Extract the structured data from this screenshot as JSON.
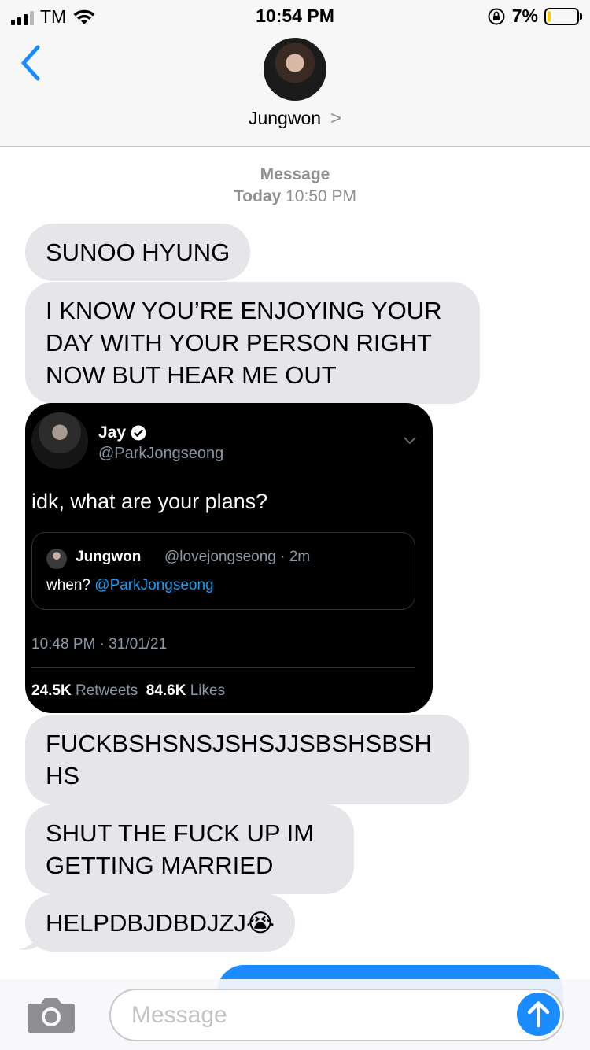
{
  "status_bar": {
    "carrier": "TM",
    "time": "10:54 PM",
    "battery": "7%",
    "battery_level": 0.07
  },
  "header": {
    "contact_name": "Jungwon",
    "contact_chevron": ">"
  },
  "conversation_meta": {
    "label": "Message",
    "day": "Today",
    "time": "10:50 PM"
  },
  "messages": [
    {
      "text": "SUNOO HYUNG"
    },
    {
      "text": "I KNOW YOU’RE ENJOYING YOUR DAY WITH YOUR PERSON RIGHT NOW BUT HEAR ME OUT"
    },
    {
      "text": "FUCKBSHSNSJSHSJJSBSHSBSH HS"
    },
    {
      "text": "SHUT THE FUCK UP IM GETTING MARRIED"
    },
    {
      "text": "HELPDBJDBDJZJ😭"
    }
  ],
  "tweet": {
    "name": "Jay",
    "handle": "@ParkJongseong",
    "text": "idk, what are your plans?",
    "quote": {
      "name": "Jungwon",
      "handle": "@lovejongseong · 2m",
      "text_prefix": "when? ",
      "mention": "@ParkJongseong"
    },
    "date": "10:48 PM · 31/01/21",
    "retweets_count": "24.5K",
    "retweets_label": "Retweets",
    "likes_count": "84.6K",
    "likes_label": "Likes"
  },
  "composer": {
    "placeholder": "Message"
  },
  "colors": {
    "incoming_bubble": "#e5e5ea",
    "outgoing_bubble": "#1a8cff",
    "tweet_bg": "#000000",
    "mention": "#1d9bf0",
    "battery_fill": "#ffcc00"
  },
  "icons": [
    "back-chevron-icon",
    "camera-icon",
    "send-arrow-icon",
    "verified-badge-icon",
    "wifi-icon",
    "rotation-lock-icon",
    "battery-icon"
  ]
}
